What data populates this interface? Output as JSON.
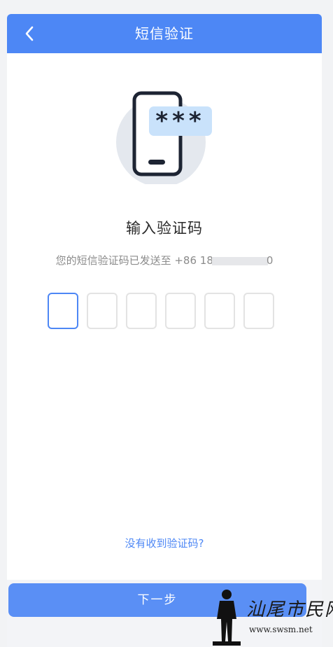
{
  "header": {
    "title": "短信验证",
    "back_icon": "chevron-left-icon"
  },
  "illustration": {
    "icon": "phone-password-icon",
    "bubble_text": "***",
    "colors": {
      "circle": "#e4e8ee",
      "bubble": "#c9e2fb",
      "outline": "#1d2433"
    }
  },
  "main": {
    "heading": "输入验证码",
    "sent_prefix": "您的短信验证码已发送至 +86 18",
    "sent_suffix": "0",
    "code_boxes": [
      "",
      "",
      "",
      "",
      "",
      ""
    ]
  },
  "resend_link": "没有收到验证码?",
  "next_button": "下一步",
  "watermark": {
    "text": "汕尾市民网",
    "url": "www.swsm.net"
  },
  "colors": {
    "accent": "#4d87f5",
    "button": "#5a8ff5"
  }
}
